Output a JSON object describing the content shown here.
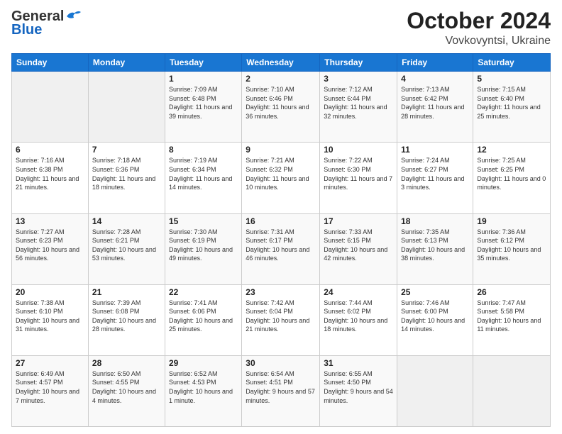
{
  "header": {
    "logo_general": "General",
    "logo_blue": "Blue",
    "month": "October 2024",
    "location": "Vovkovyntsi, Ukraine"
  },
  "weekdays": [
    "Sunday",
    "Monday",
    "Tuesday",
    "Wednesday",
    "Thursday",
    "Friday",
    "Saturday"
  ],
  "rows": [
    [
      {
        "day": "",
        "empty": true
      },
      {
        "day": "",
        "empty": true
      },
      {
        "day": "1",
        "sunrise": "Sunrise: 7:09 AM",
        "sunset": "Sunset: 6:48 PM",
        "daylight": "Daylight: 11 hours and 39 minutes."
      },
      {
        "day": "2",
        "sunrise": "Sunrise: 7:10 AM",
        "sunset": "Sunset: 6:46 PM",
        "daylight": "Daylight: 11 hours and 36 minutes."
      },
      {
        "day": "3",
        "sunrise": "Sunrise: 7:12 AM",
        "sunset": "Sunset: 6:44 PM",
        "daylight": "Daylight: 11 hours and 32 minutes."
      },
      {
        "day": "4",
        "sunrise": "Sunrise: 7:13 AM",
        "sunset": "Sunset: 6:42 PM",
        "daylight": "Daylight: 11 hours and 28 minutes."
      },
      {
        "day": "5",
        "sunrise": "Sunrise: 7:15 AM",
        "sunset": "Sunset: 6:40 PM",
        "daylight": "Daylight: 11 hours and 25 minutes."
      }
    ],
    [
      {
        "day": "6",
        "sunrise": "Sunrise: 7:16 AM",
        "sunset": "Sunset: 6:38 PM",
        "daylight": "Daylight: 11 hours and 21 minutes."
      },
      {
        "day": "7",
        "sunrise": "Sunrise: 7:18 AM",
        "sunset": "Sunset: 6:36 PM",
        "daylight": "Daylight: 11 hours and 18 minutes."
      },
      {
        "day": "8",
        "sunrise": "Sunrise: 7:19 AM",
        "sunset": "Sunset: 6:34 PM",
        "daylight": "Daylight: 11 hours and 14 minutes."
      },
      {
        "day": "9",
        "sunrise": "Sunrise: 7:21 AM",
        "sunset": "Sunset: 6:32 PM",
        "daylight": "Daylight: 11 hours and 10 minutes."
      },
      {
        "day": "10",
        "sunrise": "Sunrise: 7:22 AM",
        "sunset": "Sunset: 6:30 PM",
        "daylight": "Daylight: 11 hours and 7 minutes."
      },
      {
        "day": "11",
        "sunrise": "Sunrise: 7:24 AM",
        "sunset": "Sunset: 6:27 PM",
        "daylight": "Daylight: 11 hours and 3 minutes."
      },
      {
        "day": "12",
        "sunrise": "Sunrise: 7:25 AM",
        "sunset": "Sunset: 6:25 PM",
        "daylight": "Daylight: 11 hours and 0 minutes."
      }
    ],
    [
      {
        "day": "13",
        "sunrise": "Sunrise: 7:27 AM",
        "sunset": "Sunset: 6:23 PM",
        "daylight": "Daylight: 10 hours and 56 minutes."
      },
      {
        "day": "14",
        "sunrise": "Sunrise: 7:28 AM",
        "sunset": "Sunset: 6:21 PM",
        "daylight": "Daylight: 10 hours and 53 minutes."
      },
      {
        "day": "15",
        "sunrise": "Sunrise: 7:30 AM",
        "sunset": "Sunset: 6:19 PM",
        "daylight": "Daylight: 10 hours and 49 minutes."
      },
      {
        "day": "16",
        "sunrise": "Sunrise: 7:31 AM",
        "sunset": "Sunset: 6:17 PM",
        "daylight": "Daylight: 10 hours and 46 minutes."
      },
      {
        "day": "17",
        "sunrise": "Sunrise: 7:33 AM",
        "sunset": "Sunset: 6:15 PM",
        "daylight": "Daylight: 10 hours and 42 minutes."
      },
      {
        "day": "18",
        "sunrise": "Sunrise: 7:35 AM",
        "sunset": "Sunset: 6:13 PM",
        "daylight": "Daylight: 10 hours and 38 minutes."
      },
      {
        "day": "19",
        "sunrise": "Sunrise: 7:36 AM",
        "sunset": "Sunset: 6:12 PM",
        "daylight": "Daylight: 10 hours and 35 minutes."
      }
    ],
    [
      {
        "day": "20",
        "sunrise": "Sunrise: 7:38 AM",
        "sunset": "Sunset: 6:10 PM",
        "daylight": "Daylight: 10 hours and 31 minutes."
      },
      {
        "day": "21",
        "sunrise": "Sunrise: 7:39 AM",
        "sunset": "Sunset: 6:08 PM",
        "daylight": "Daylight: 10 hours and 28 minutes."
      },
      {
        "day": "22",
        "sunrise": "Sunrise: 7:41 AM",
        "sunset": "Sunset: 6:06 PM",
        "daylight": "Daylight: 10 hours and 25 minutes."
      },
      {
        "day": "23",
        "sunrise": "Sunrise: 7:42 AM",
        "sunset": "Sunset: 6:04 PM",
        "daylight": "Daylight: 10 hours and 21 minutes."
      },
      {
        "day": "24",
        "sunrise": "Sunrise: 7:44 AM",
        "sunset": "Sunset: 6:02 PM",
        "daylight": "Daylight: 10 hours and 18 minutes."
      },
      {
        "day": "25",
        "sunrise": "Sunrise: 7:46 AM",
        "sunset": "Sunset: 6:00 PM",
        "daylight": "Daylight: 10 hours and 14 minutes."
      },
      {
        "day": "26",
        "sunrise": "Sunrise: 7:47 AM",
        "sunset": "Sunset: 5:58 PM",
        "daylight": "Daylight: 10 hours and 11 minutes."
      }
    ],
    [
      {
        "day": "27",
        "sunrise": "Sunrise: 6:49 AM",
        "sunset": "Sunset: 4:57 PM",
        "daylight": "Daylight: 10 hours and 7 minutes."
      },
      {
        "day": "28",
        "sunrise": "Sunrise: 6:50 AM",
        "sunset": "Sunset: 4:55 PM",
        "daylight": "Daylight: 10 hours and 4 minutes."
      },
      {
        "day": "29",
        "sunrise": "Sunrise: 6:52 AM",
        "sunset": "Sunset: 4:53 PM",
        "daylight": "Daylight: 10 hours and 1 minute."
      },
      {
        "day": "30",
        "sunrise": "Sunrise: 6:54 AM",
        "sunset": "Sunset: 4:51 PM",
        "daylight": "Daylight: 9 hours and 57 minutes."
      },
      {
        "day": "31",
        "sunrise": "Sunrise: 6:55 AM",
        "sunset": "Sunset: 4:50 PM",
        "daylight": "Daylight: 9 hours and 54 minutes."
      },
      {
        "day": "",
        "empty": true
      },
      {
        "day": "",
        "empty": true
      }
    ]
  ]
}
